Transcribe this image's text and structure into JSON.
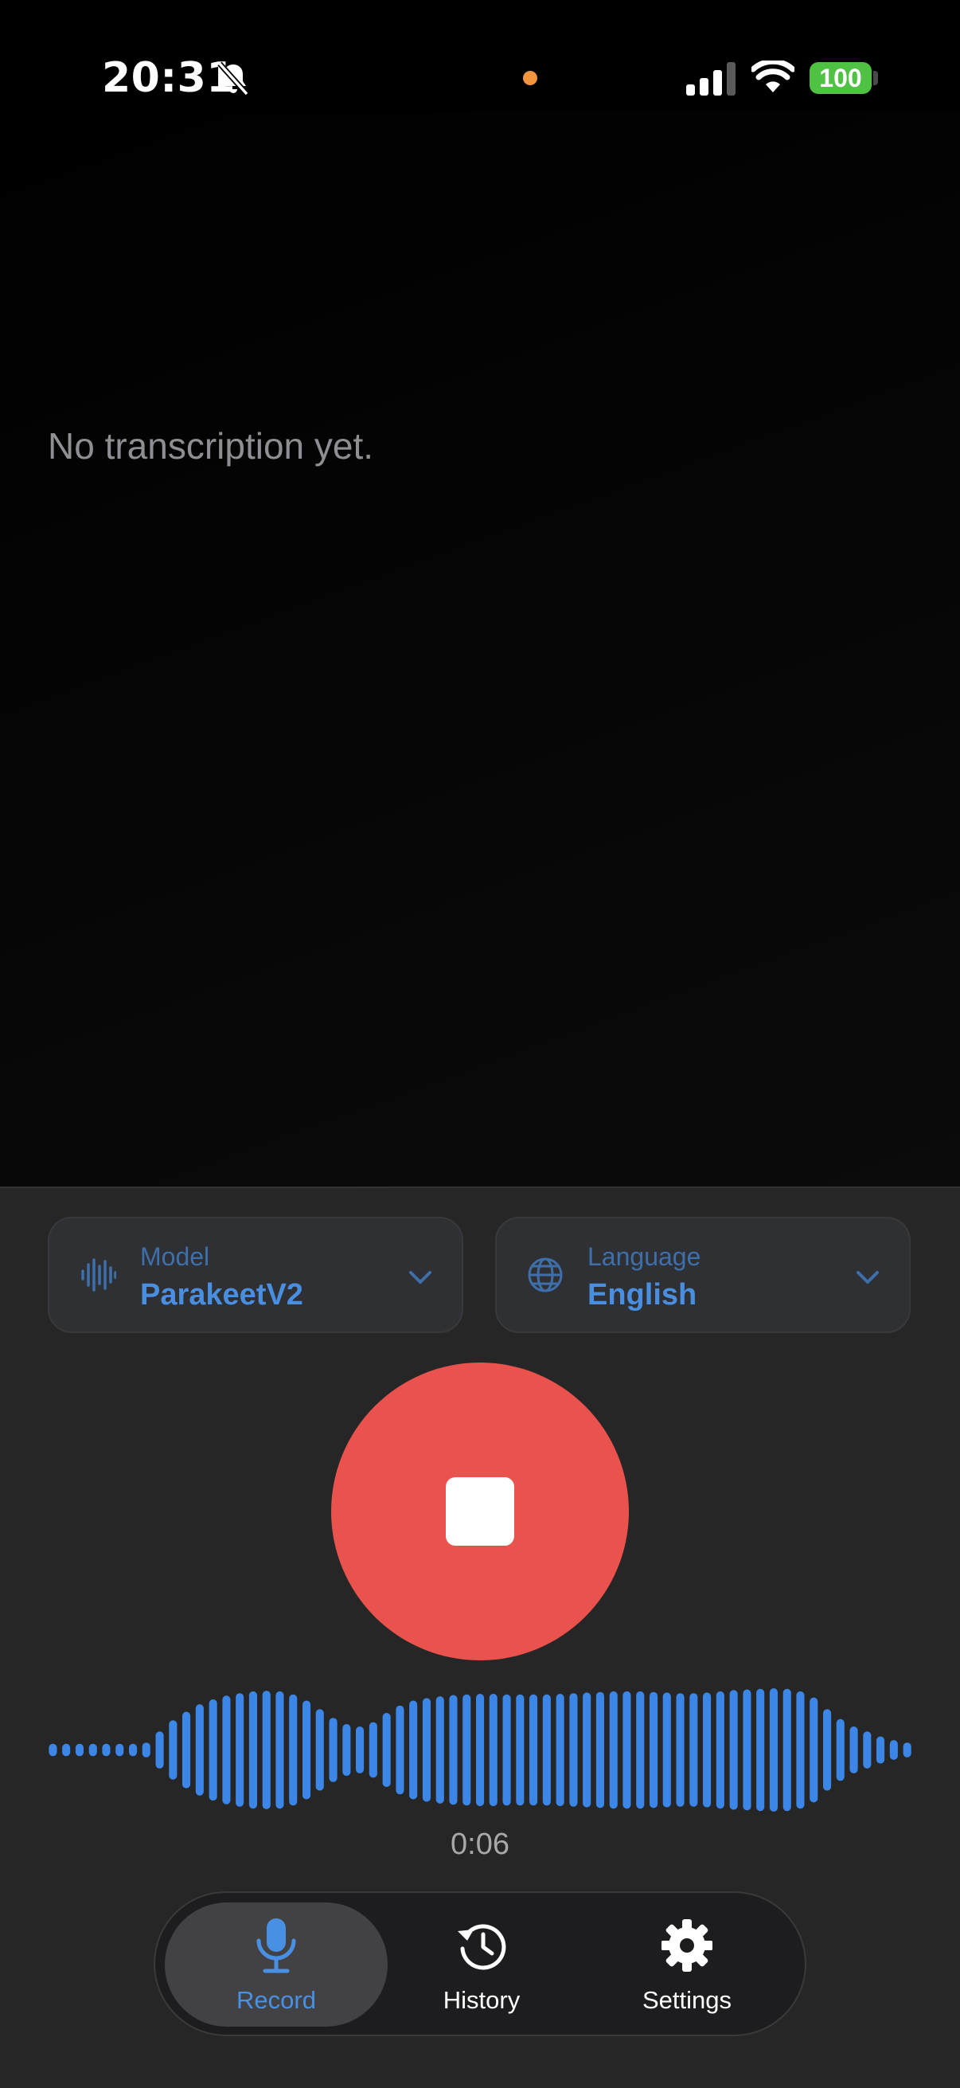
{
  "status_bar": {
    "time": "20:31",
    "battery": "100",
    "icons": [
      "bell-slash-icon",
      "mic-in-use-dot",
      "cellular-signal-icon",
      "wifi-icon",
      "battery-icon"
    ]
  },
  "transcript": {
    "placeholder": "No transcription yet."
  },
  "model_selector": {
    "label": "Model",
    "value": "ParakeetV2",
    "icon": "waveform-icon"
  },
  "language_selector": {
    "label": "Language",
    "value": "English",
    "icon": "globe-icon"
  },
  "recorder": {
    "state": "recording",
    "button_icon": "stop-icon",
    "elapsed": "0:06",
    "waveform_levels": [
      0.1,
      0.1,
      0.1,
      0.1,
      0.1,
      0.1,
      0.1,
      0.12,
      0.3,
      0.48,
      0.62,
      0.74,
      0.82,
      0.88,
      0.92,
      0.95,
      0.96,
      0.95,
      0.9,
      0.8,
      0.66,
      0.52,
      0.42,
      0.38,
      0.45,
      0.6,
      0.72,
      0.8,
      0.84,
      0.87,
      0.89,
      0.9,
      0.91,
      0.91,
      0.9,
      0.9,
      0.9,
      0.9,
      0.91,
      0.92,
      0.93,
      0.94,
      0.95,
      0.95,
      0.95,
      0.94,
      0.93,
      0.92,
      0.92,
      0.93,
      0.95,
      0.97,
      0.98,
      0.99,
      1.0,
      0.99,
      0.95,
      0.85,
      0.66,
      0.5,
      0.38,
      0.3,
      0.22,
      0.16,
      0.12
    ],
    "colors": {
      "waveform": "#3b86e6",
      "button": "#e9524d",
      "accent": "#4a8ee0"
    }
  },
  "tabs": [
    {
      "label": "Record",
      "icon": "mic-icon",
      "active": true
    },
    {
      "label": "History",
      "icon": "history-icon",
      "active": false
    },
    {
      "label": "Settings",
      "icon": "gear-icon",
      "active": false
    }
  ]
}
